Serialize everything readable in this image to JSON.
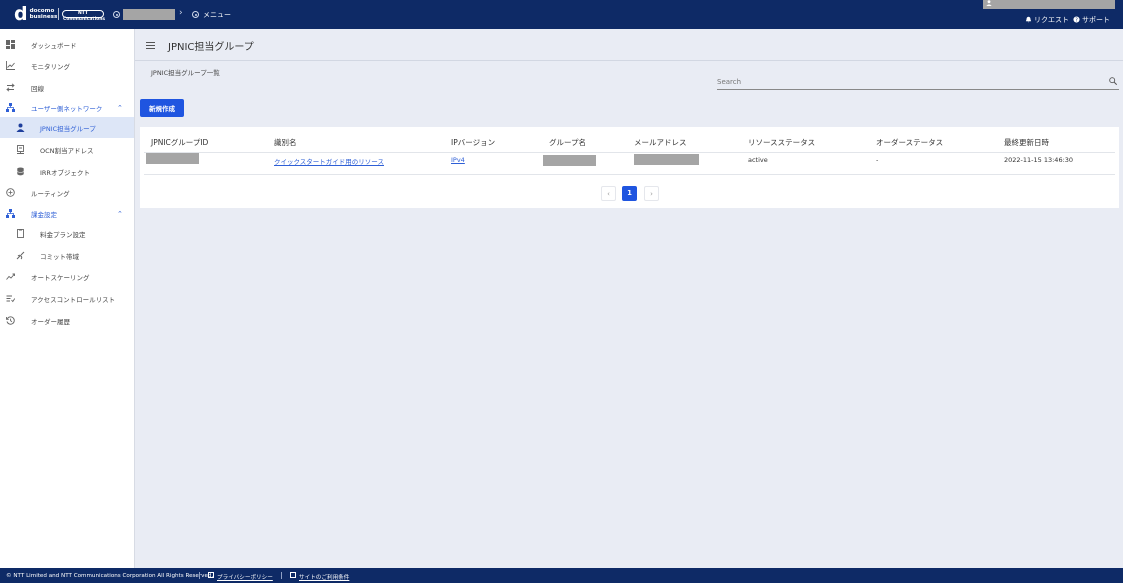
{
  "header": {
    "logo_main": "d",
    "logo_line1": "docomo",
    "logo_line2": "business",
    "ntt_logo": "NTT Communications",
    "menu_label": "メニュー",
    "request_label": "リクエスト",
    "support_label": "サポート",
    "chevron": "›"
  },
  "sidebar": {
    "items": [
      {
        "label": "ダッシュボード",
        "icon": "dashboard-icon"
      },
      {
        "label": "モニタリング",
        "icon": "chart-icon"
      },
      {
        "label": "回線",
        "icon": "line-icon"
      },
      {
        "label": "ユーザー側ネットワーク",
        "icon": "network-icon",
        "caret": "⌃"
      },
      {
        "label": "JPNIC担当グループ",
        "icon": "person-icon"
      },
      {
        "label": "OCN割当アドレス",
        "icon": "server-icon"
      },
      {
        "label": "IRRオブジェクト",
        "icon": "database-icon"
      },
      {
        "label": "ルーティング",
        "icon": "routing-icon"
      },
      {
        "label": "課金設定",
        "icon": "billing-icon",
        "caret": "⌃"
      },
      {
        "label": "料金プラン設定",
        "icon": "document-icon"
      },
      {
        "label": "コミット帯域",
        "icon": "commit-icon"
      },
      {
        "label": "オートスケーリング",
        "icon": "autoscale-icon"
      },
      {
        "label": "アクセスコントロールリスト",
        "icon": "acl-icon"
      },
      {
        "label": "オーダー履歴",
        "icon": "history-icon"
      }
    ]
  },
  "main": {
    "page_title": "JPNIC担当グループ",
    "subtitle": "JPNIC担当グループ一覧",
    "search_placeholder": "Search",
    "new_button": "新規作成",
    "table": {
      "headers": [
        "JPNICグループID",
        "識別名",
        "IPバージョン",
        "グループ名",
        "メールアドレス",
        "リソースステータス",
        "オーダーステータス",
        "最終更新日時"
      ],
      "rows": [
        {
          "distinguished_name": "クイックスタートガイド用のリソース",
          "ip_version": "IPv4",
          "resource_status": "active",
          "order_status": "-",
          "updated_at": "2022-11-15 13:46:30"
        }
      ]
    },
    "pagination": {
      "prev": "‹",
      "current": "1",
      "next": "›"
    }
  },
  "footer": {
    "copyright": "© NTT Limited and NTT Communications Corporation All Rights Reserved.",
    "privacy": "プライバシーポリシー",
    "terms": "サイトのご利用条件"
  },
  "colors": {
    "header_bg": "#0e2a66",
    "accent": "#1f55e0",
    "link": "#2e5fd6",
    "active_bg": "#dde6f7"
  }
}
